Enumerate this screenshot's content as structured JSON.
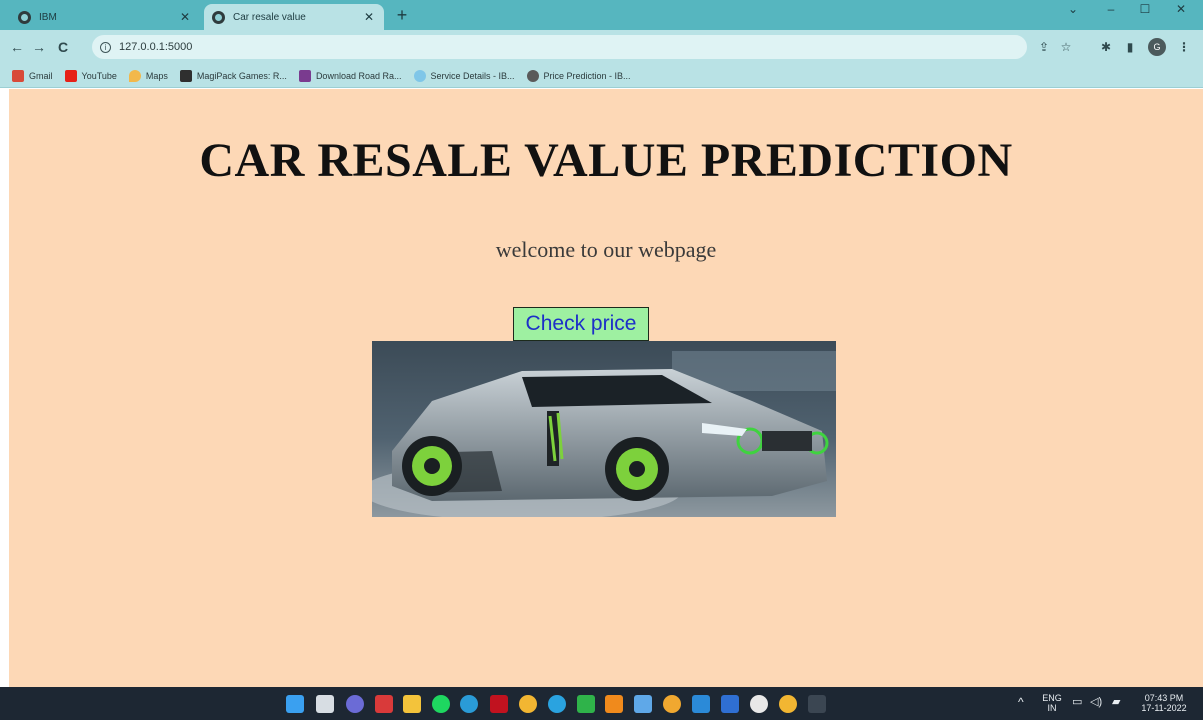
{
  "browser": {
    "tabs": [
      {
        "title": "IBM",
        "active": false
      },
      {
        "title": "Car resale value",
        "active": true
      }
    ],
    "new_tab_label": "+",
    "window_controls": {
      "minimize": "–",
      "maximize": "☐",
      "close": "✕",
      "dropdown": "⌄"
    },
    "url": "127.0.0.1:5000",
    "nav": {
      "back": "←",
      "forward": "→",
      "reload": "C"
    },
    "toolbar_icons": {
      "share": "⇪",
      "star": "☆",
      "extensions": "✱",
      "sidepanel": "▮",
      "menu": "⋮"
    },
    "profile_initial": "G",
    "bookmarks": [
      {
        "label": "Gmail",
        "icon": "gmail-icon",
        "color": "#d84a38"
      },
      {
        "label": "YouTube",
        "icon": "youtube-icon",
        "color": "#e62117"
      },
      {
        "label": "Maps",
        "icon": "maps-icon",
        "color": "#f2b84b"
      },
      {
        "label": "MagiPack Games: R...",
        "icon": "magipack-icon",
        "color": "#2f2f2f"
      },
      {
        "label": "Download Road Ra...",
        "icon": "road-rash-icon",
        "color": "#7a3b8f"
      },
      {
        "label": "Service Details - IB...",
        "icon": "cloud-icon",
        "color": "#7fc6e8"
      },
      {
        "label": "Price Prediction - IB...",
        "icon": "bulb-icon",
        "color": "#5a5a5a"
      }
    ]
  },
  "page": {
    "title": "CAR RESALE VALUE PREDICTION",
    "welcome": "welcome to our webpage",
    "check_price_button": "Check price",
    "background_color": "#fdd8b6",
    "button_color": "#9ef0a1",
    "button_text_color": "#1d2fc8"
  },
  "taskbar": {
    "apps": [
      {
        "icon": "windows-start-icon",
        "color": "#3aa0f0"
      },
      {
        "icon": "task-view-icon",
        "color": "#d7dde3"
      },
      {
        "icon": "teams-chat-icon",
        "color": "#6b6bd6"
      },
      {
        "icon": "red-app-icon",
        "color": "#d93a3a"
      },
      {
        "icon": "file-explorer-icon",
        "color": "#f3c33b"
      },
      {
        "icon": "spotify-icon",
        "color": "#1ed760"
      },
      {
        "icon": "edge-icon",
        "color": "#2a9bd7"
      },
      {
        "icon": "netflix-icon",
        "color": "#c1121f"
      },
      {
        "icon": "chrome-icon",
        "color": "#f2b632"
      },
      {
        "icon": "telegram-icon",
        "color": "#2aa3e0"
      },
      {
        "icon": "xbox-icon",
        "color": "#2fb34a"
      },
      {
        "icon": "vlc-icon",
        "color": "#f08a1c"
      },
      {
        "icon": "notepad-icon",
        "color": "#5fa8e8"
      },
      {
        "icon": "chrome-canary-icon",
        "color": "#f0a830"
      },
      {
        "icon": "vscode-icon",
        "color": "#2b8ad8"
      },
      {
        "icon": "word-icon",
        "color": "#2f6fd3"
      },
      {
        "icon": "github-icon",
        "color": "#e8e8e8"
      },
      {
        "icon": "chrome-dev-icon",
        "color": "#f2b632"
      },
      {
        "icon": "terminal-icon",
        "color": "#3b4652"
      }
    ],
    "tray": {
      "chevron": "^",
      "lang_top": "ENG",
      "lang_bottom": "IN",
      "time": "07:43 PM",
      "date": "17-11-2022"
    }
  }
}
